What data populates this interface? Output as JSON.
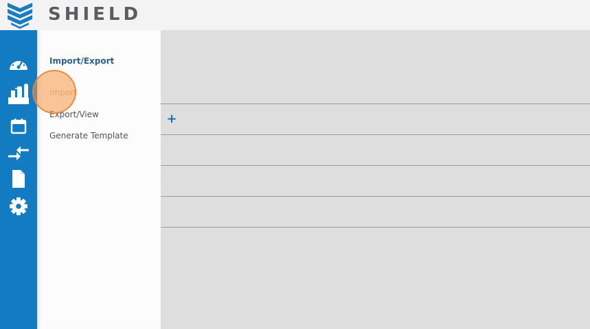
{
  "header": {
    "brand": "SHIELD",
    "logo_icon": "shield-chevron-logo-icon",
    "logo_color": "#1a7cc1"
  },
  "sidebar": {
    "color": "#137bc2",
    "items": [
      {
        "icon": "dashboard-gauge-icon"
      },
      {
        "icon": "plant-facility-icon"
      },
      {
        "icon": "calendar-icon"
      },
      {
        "icon": "import-export-arrows-icon"
      },
      {
        "icon": "document-icon"
      },
      {
        "icon": "settings-gear-icon"
      }
    ]
  },
  "submenu": {
    "title": "Import/Export",
    "items": [
      {
        "label": "Import",
        "active": true
      },
      {
        "label": "Export/View",
        "active": false
      },
      {
        "label": "Generate Template",
        "active": false
      }
    ]
  },
  "main": {
    "add_label": "+",
    "row_count": 4
  },
  "highlight_color": "#f49646"
}
